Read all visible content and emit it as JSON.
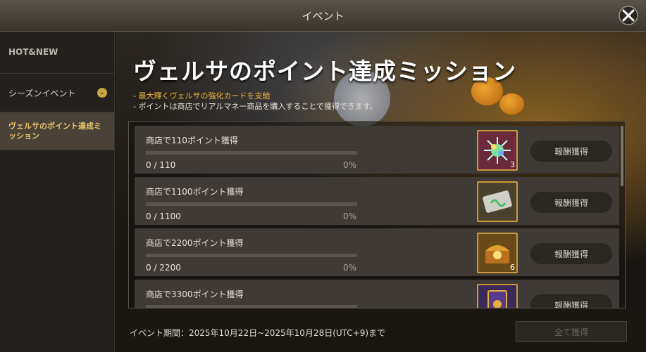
{
  "window": {
    "title": "イベント"
  },
  "sidebar": {
    "header": "HOT&NEW",
    "items": [
      {
        "label": "シーズンイベント"
      },
      {
        "label": "ヴェルサのポイント達成ミッション"
      }
    ]
  },
  "banner": {
    "title": "ヴェルサのポイント達成ミッション",
    "note_highlight": "- 最大輝くヴェルサの強化カードを支給",
    "note_normal": "- ポイントは商店でリアルマネー商品を購入することで獲得できます。"
  },
  "missions": [
    {
      "label": "商店で110ポイント獲得",
      "progress": "0 / 110",
      "percent": "0%",
      "reward_icon": "crystal-icon",
      "count": "3",
      "claim": "報酬獲得"
    },
    {
      "label": "商店で1100ポイント獲得",
      "progress": "0 / 1100",
      "percent": "0%",
      "reward_icon": "ticket-icon",
      "count": "",
      "claim": "報酬獲得"
    },
    {
      "label": "商店で2200ポイント獲得",
      "progress": "0 / 2200",
      "percent": "0%",
      "reward_icon": "treasure-chest-icon",
      "count": "6",
      "claim": "報酬獲得"
    },
    {
      "label": "商店で3300ポイント獲得",
      "progress": "",
      "percent": "",
      "reward_icon": "card-icon",
      "count": "",
      "claim": "報酬獲得"
    }
  ],
  "footer": {
    "period": "イベント期間：2025年10月22日~2025年10月28日(UTC+9)まで",
    "claim_all": "全て獲得"
  }
}
